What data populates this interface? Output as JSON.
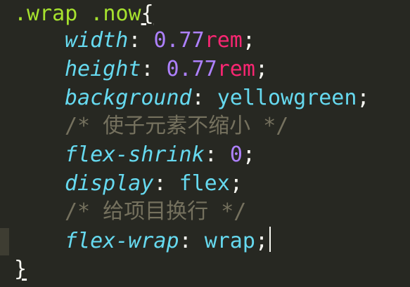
{
  "code": {
    "selector": ".wrap .now",
    "open_brace": "{",
    "close_brace": "}",
    "lines": [
      {
        "prop": "width",
        "colon": ": ",
        "num": "0.77",
        "unit": "rem",
        "semi": ";"
      },
      {
        "prop": "height",
        "colon": ": ",
        "num": "0.77",
        "unit": "rem",
        "semi": ";"
      },
      {
        "prop": "background",
        "colon": ": ",
        "value": "yellowgreen",
        "semi": ";"
      },
      {
        "comment": "/* 使子元素不缩小 */"
      },
      {
        "prop": "flex-shrink",
        "colon": ": ",
        "num": "0",
        "semi": ";"
      },
      {
        "prop": "display",
        "colon": ": ",
        "value": "flex",
        "semi": ";"
      },
      {
        "comment": "/* 给项目换行 */"
      },
      {
        "prop": "flex-wrap",
        "colon": ": ",
        "value": "wrap",
        "semi": ";"
      }
    ]
  },
  "colors": {
    "background": "#272822",
    "selector": "#a6e22e",
    "property": "#66d9ef",
    "number": "#ae81ff",
    "unit": "#f92672",
    "comment": "#75715e",
    "text": "#f8f8f2"
  }
}
